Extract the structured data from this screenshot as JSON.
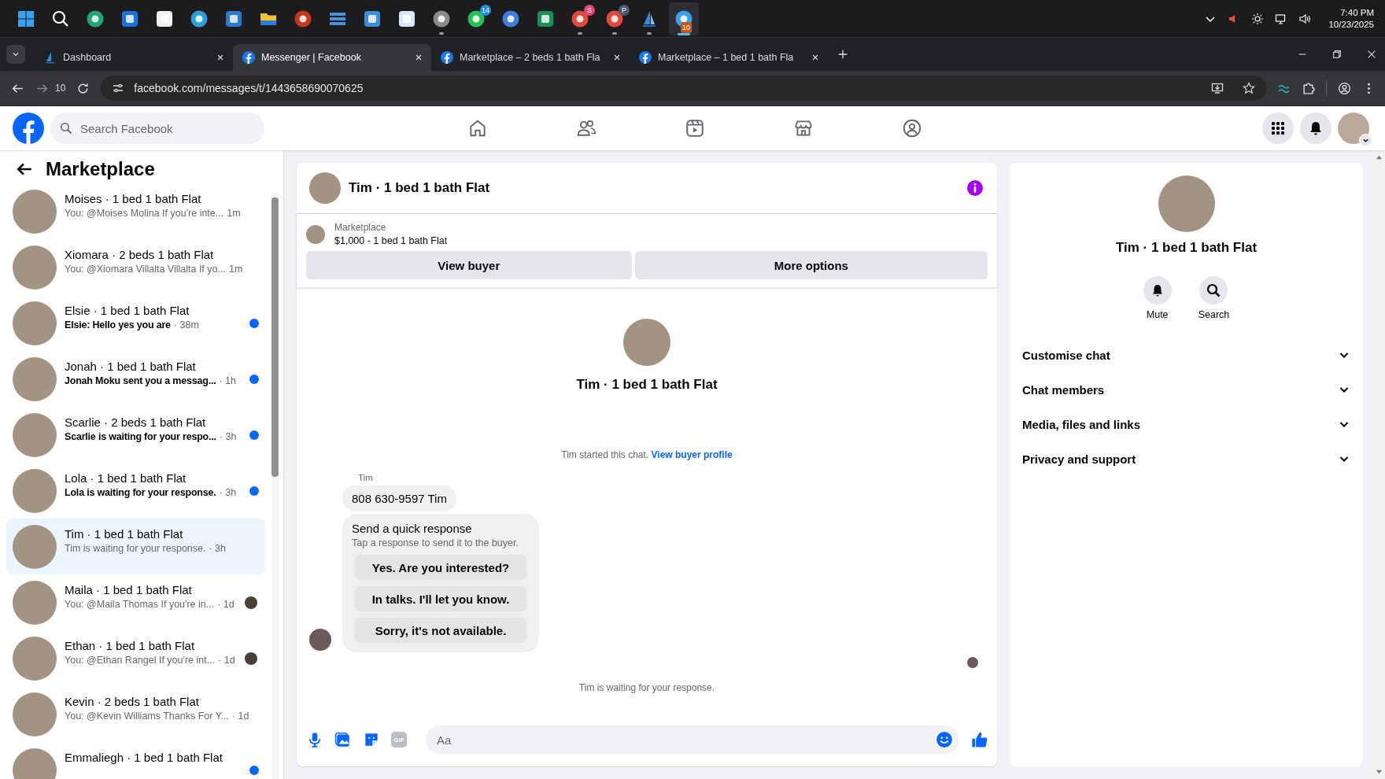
{
  "taskbar": {
    "apps": [
      {
        "kind": "start",
        "running": false,
        "selected": false
      },
      {
        "kind": "search",
        "running": false,
        "selected": false
      },
      {
        "kind": "edge",
        "running": false,
        "selected": false
      },
      {
        "kind": "outlook",
        "running": false,
        "selected": false
      },
      {
        "kind": "store",
        "running": false,
        "selected": false
      },
      {
        "kind": "telegram",
        "running": false,
        "selected": false
      },
      {
        "kind": "media",
        "running": false,
        "selected": false
      },
      {
        "kind": "folder",
        "running": false,
        "selected": false
      },
      {
        "kind": "audio",
        "running": false,
        "selected": false
      },
      {
        "kind": "server",
        "running": false,
        "selected": false
      },
      {
        "kind": "notepad",
        "running": false,
        "selected": false
      },
      {
        "kind": "maze",
        "running": false,
        "selected": false
      },
      {
        "kind": "mascot",
        "running": true,
        "selected": false
      },
      {
        "kind": "whatsapp",
        "running": false,
        "selected": false,
        "badge": {
          "text": "14",
          "color": "#1f8ef1"
        }
      },
      {
        "kind": "ring",
        "running": false,
        "selected": false
      },
      {
        "kind": "qo",
        "running": false,
        "selected": false
      },
      {
        "kind": "chrome",
        "running": true,
        "selected": false,
        "badge": {
          "text": "S",
          "color": "#e8457a"
        }
      },
      {
        "kind": "chrome",
        "running": true,
        "selected": false,
        "badge": {
          "text": "P",
          "color": "#4a5a6a"
        }
      },
      {
        "kind": "sail",
        "running": true,
        "selected": false
      },
      {
        "kind": "gauge",
        "running": true,
        "selected": true,
        "badge": {
          "text": "10",
          "color": "#c5581c"
        }
      }
    ],
    "time": "7:40 PM",
    "date": "10/23/2025"
  },
  "tabs": [
    {
      "title": "Dashboard",
      "kind": "sail",
      "selected": false
    },
    {
      "title": "Messenger | Facebook",
      "kind": "facebook",
      "selected": true
    },
    {
      "title": "Marketplace – 2 beds 1 bath Fla",
      "kind": "facebook",
      "selected": false
    },
    {
      "title": "Marketplace – 1 bed 1 bath Fla",
      "kind": "facebook",
      "selected": false
    }
  ],
  "address_bar": {
    "history_count": "10",
    "url": "facebook.com/messages/t/1443658690070625"
  },
  "header": {
    "search_placeholder": "Search Facebook"
  },
  "sidebar": {
    "title": "Marketplace",
    "conversations": [
      {
        "title": "Moises · 1 bed 1 bath Flat",
        "preview": "You: @Moises Molina If you're inte...",
        "time": "1m",
        "unread": false,
        "seen": false,
        "selected": false
      },
      {
        "title": "Xiomara · 2 beds 1 bath Flat",
        "preview": "You: @Xiomara Villalta Villalta If yo...",
        "time": "1m",
        "unread": false,
        "seen": false,
        "selected": false
      },
      {
        "title": "Elsie · 1 bed 1 bath Flat",
        "preview": "Elsie: Hello yes you are",
        "time": "· 38m",
        "unread": true,
        "seen": false,
        "selected": false
      },
      {
        "title": "Jonah · 1 bed 1 bath Flat",
        "preview": "Jonah Moku sent you a messag...",
        "time": "· 1h",
        "unread": true,
        "seen": false,
        "selected": false
      },
      {
        "title": "Scarlie · 2 beds 1 bath Flat",
        "preview": "Scarlie is waiting for your respo...",
        "time": "· 3h",
        "unread": true,
        "seen": false,
        "selected": false
      },
      {
        "title": "Lola · 1 bed 1 bath Flat",
        "preview": "Lola is waiting for your response.",
        "time": "· 3h",
        "unread": true,
        "seen": false,
        "selected": false
      },
      {
        "title": "Tim · 1 bed 1 bath Flat",
        "preview": "Tim is waiting for your response.",
        "time": "· 3h",
        "unread": false,
        "seen": false,
        "selected": true
      },
      {
        "title": "Maila · 1 bed 1 bath Flat",
        "preview": "You: @Maila Thomas If you're in...",
        "time": "· 1d",
        "unread": false,
        "seen": true,
        "selected": false
      },
      {
        "title": "Ethan · 1 bed 1 bath Flat",
        "preview": "You: @Ethan Rangel If you're int...",
        "time": "· 1d",
        "unread": false,
        "seen": true,
        "selected": false
      },
      {
        "title": "Kevin · 2 beds 1 bath Flat",
        "preview": "You: @Kevin Williams Thanks For Y...",
        "time": "· 1d",
        "unread": false,
        "seen": false,
        "selected": false
      },
      {
        "title": "Emmaliegh · 1 bed 1 bath Flat",
        "unread": true,
        "seen": false,
        "selected": false
      }
    ]
  },
  "chat": {
    "title": "Tim · 1 bed 1 bath Flat",
    "listing": {
      "source": "Marketplace",
      "title": "$1,000 - 1 bed 1 bath Flat"
    },
    "buttons": [
      "View buyer",
      "More options"
    ],
    "intro_title": "Tim · 1 bed 1 bath Flat",
    "started_text": "Tim started this chat.",
    "started_link": "View buyer profile",
    "sender": "Tim",
    "message": "808 630-9597 Tim",
    "quick_response": {
      "title": "Send a quick response",
      "subtitle": "Tap a response to send it to the buyer.",
      "options": [
        "Yes. Are you interested?",
        "In talks. I'll let you know.",
        "Sorry, it's not available."
      ]
    },
    "status": "Tim is waiting for your response.",
    "composer": {
      "gif_label": "GIF",
      "placeholder": "Aa"
    }
  },
  "details": {
    "title": "Tim · 1 bed 1 bath Flat",
    "actions": [
      {
        "kind": "bell",
        "label": "Mute"
      },
      {
        "kind": "search",
        "label": "Search"
      }
    ],
    "sections": [
      {
        "label": "Customise chat",
        "expanded": false
      },
      {
        "label": "Chat members",
        "expanded": false
      },
      {
        "label": "Media, files and links",
        "expanded": false
      },
      {
        "label": "Privacy and support",
        "expanded": false
      }
    ]
  }
}
